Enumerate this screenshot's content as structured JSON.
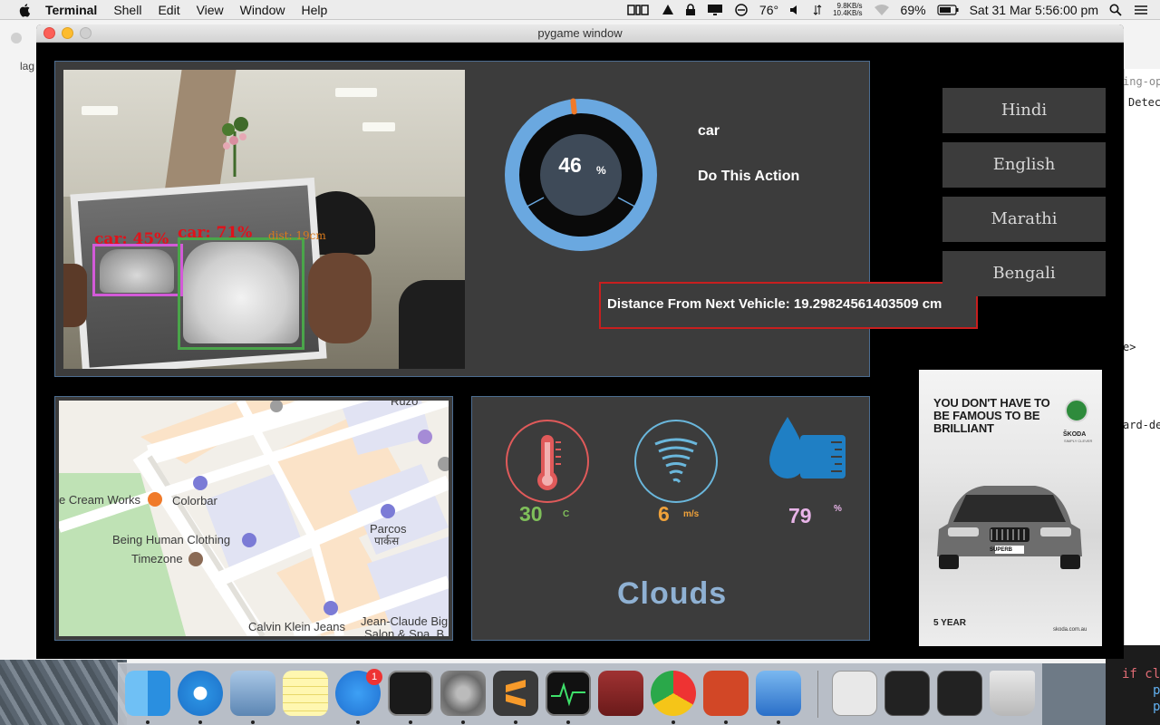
{
  "menubar": {
    "app": "Terminal",
    "items": [
      "Shell",
      "Edit",
      "View",
      "Window",
      "Help"
    ],
    "temperature": "76°",
    "net_up": "9.8KB/s",
    "net_down": "10.4KB/s",
    "battery": "69%",
    "clock": "Sat 31 Mar  5:56:00 pm"
  },
  "background": {
    "lag_text": "lag",
    "right_lines": [
      "ing-op",
      "Detec",
      "e>",
      "ard-de"
    ],
    "bottom_lines": [
      "if cl",
      "p",
      "p"
    ]
  },
  "window": {
    "title": "pygame window"
  },
  "camera": {
    "label_car1": "car: 45%",
    "label_car2": "car: 71%",
    "dist_label": "dist: 19cm",
    "box_colors": {
      "car1": "#d35ad8",
      "car2": "#4aa54a"
    }
  },
  "gauge": {
    "value": "46",
    "unit": "%",
    "percent": 46
  },
  "detection": {
    "object": "car",
    "action": "Do This Action"
  },
  "distance": {
    "text": "Distance From Next Vehicle: 19.29824561403509 cm"
  },
  "languages": [
    "Hindi",
    "English",
    "Marathi",
    "Bengali"
  ],
  "ad": {
    "headline": "YOU DON'T HAVE TO BE FAMOUS TO BE BRILLIANT",
    "brand": "ŠKODA",
    "tagline": "SIMPLY CLEVER",
    "model": "SUPERB",
    "badge": "5 YEAR",
    "site": "skoda.com.au"
  },
  "map": {
    "labels": [
      "Ruzo",
      "e Cream Works",
      "Colorbar",
      "Being Human Clothing",
      "Timezone",
      "Parcos",
      "पार्कस",
      "Calvin Klein Jeans",
      "Jean-Claude Big",
      "Salon & Spa, B"
    ]
  },
  "weather": {
    "temp": "30",
    "temp_unit": "C",
    "wind": "6",
    "wind_unit": "m/s",
    "humidity": "79",
    "humidity_unit": "%",
    "condition": "Clouds",
    "colors": {
      "temp": "#7fbf5a",
      "wind": "#f0a23a",
      "humidity": "#e8b4e8",
      "condition": "#8fb1d3"
    }
  },
  "dock": {
    "apps": [
      "finder-icon",
      "safari-icon",
      "preview-icon",
      "notes-icon",
      "app-store-icon",
      "terminal-icon",
      "system-preferences-icon",
      "sublime-text-icon",
      "activity-monitor-icon",
      "dictionary-icon",
      "chrome-icon",
      "powerpoint-icon",
      "keynote-icon",
      "downloads-stack-icon",
      "window-thumb-1",
      "window-thumb-2",
      "trash-icon"
    ],
    "appstore_badge": "1"
  }
}
